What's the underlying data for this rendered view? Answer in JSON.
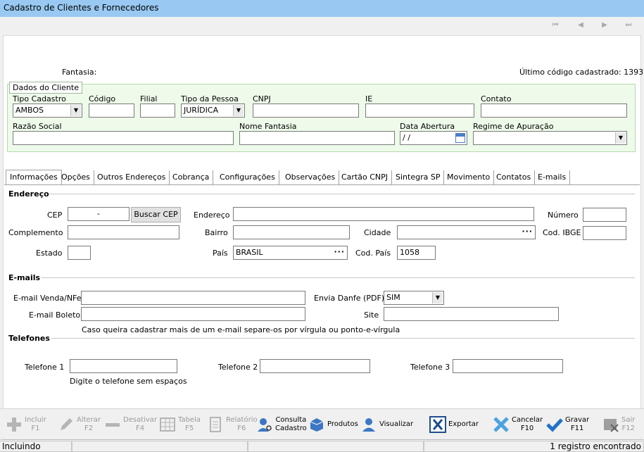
{
  "window": {
    "title": "Cadastro de Clientes e Fornecedores"
  },
  "nav": {
    "first": "⏮",
    "prev": "◀",
    "next": "▶",
    "last": "⏭"
  },
  "header": {
    "fantasia_label": "Fantasia:",
    "last_code": "Último código cadastrado: 1393"
  },
  "cliente": {
    "title": "Dados do Cliente",
    "tipo_cadastro": {
      "label": "Tipo Cadastro",
      "value": "AMBOS"
    },
    "codigo": {
      "label": "Código",
      "value": ""
    },
    "filial": {
      "label": "Filial",
      "value": ""
    },
    "tipo_pessoa": {
      "label": "Tipo da Pessoa",
      "value": "JURÍDICA"
    },
    "cnpj": {
      "label": "CNPJ",
      "value": ""
    },
    "ie": {
      "label": "IE",
      "value": ""
    },
    "contato": {
      "label": "Contato",
      "value": ""
    },
    "razao_social": {
      "label": "Razão Social",
      "value": ""
    },
    "nome_fantasia": {
      "label": "Nome Fantasia",
      "value": ""
    },
    "data_abertura": {
      "label": "Data Abertura",
      "value": " / /"
    },
    "regime": {
      "label": "Regime de Apuração",
      "value": ""
    }
  },
  "tabs": [
    "Informações",
    "Opções",
    "Outros Endereços",
    "Cobrança",
    "Configurações",
    "Observações",
    "Cartão CNPJ",
    "Sintegra SP",
    "Movimento",
    "Contatos",
    "E-mails"
  ],
  "endereco": {
    "section": "Endereço",
    "cep": {
      "label": "CEP",
      "value": "-"
    },
    "buscar_cep": "Buscar CEP",
    "endereco": {
      "label": "Endereço",
      "value": ""
    },
    "numero": {
      "label": "Número",
      "value": ""
    },
    "complemento": {
      "label": "Complemento",
      "value": ""
    },
    "bairro": {
      "label": "Bairro",
      "value": ""
    },
    "cidade": {
      "label": "Cidade",
      "value": ""
    },
    "cod_ibge": {
      "label": "Cod. IBGE",
      "value": ""
    },
    "estado": {
      "label": "Estado",
      "value": ""
    },
    "pais": {
      "label": "País",
      "value": "BRASIL"
    },
    "cod_pais": {
      "label": "Cod. País",
      "value": "1058"
    }
  },
  "emails": {
    "section": "E-mails",
    "venda": {
      "label": "E-mail Venda/NFe",
      "value": ""
    },
    "danfe": {
      "label": "Envia Danfe (PDF)",
      "value": "SIM"
    },
    "boleto": {
      "label": "E-mail Boleto",
      "value": ""
    },
    "site": {
      "label": "Site",
      "value": ""
    },
    "hint": "Caso queira cadastrar mais de um e-mail separe-os por vírgula ou ponto-e-vírgula"
  },
  "telefones": {
    "section": "Telefones",
    "tel1": {
      "label": "Telefone 1",
      "value": ""
    },
    "tel2": {
      "label": "Telefone 2",
      "value": ""
    },
    "tel3": {
      "label": "Telefone 3",
      "value": ""
    },
    "hint": "Digite o telefone sem espaços"
  },
  "toolbar": {
    "incluir": {
      "l1": "Incluir",
      "l2": "F1"
    },
    "alterar": {
      "l1": "Alterar",
      "l2": "F2"
    },
    "desativar": {
      "l1": "Desativar",
      "l2": "F4"
    },
    "tabela": {
      "l1": "Tabela",
      "l2": "F5"
    },
    "relatorio": {
      "l1": "Relatório",
      "l2": "F6"
    },
    "consulta": {
      "l1": "Consulta",
      "l2": "Cadastro"
    },
    "produtos": "Produtos",
    "visualizar": "Visualizar",
    "exportar": "Exportar",
    "cancelar": {
      "l1": "Cancelar",
      "l2": "F10"
    },
    "gravar": {
      "l1": "Gravar",
      "l2": "F11"
    },
    "sair": {
      "l1": "Sair",
      "l2": "F12"
    }
  },
  "status": {
    "mode": "Incluindo",
    "records": "1 registro encontrado"
  },
  "colors": {
    "titlebar": "#99c9f2",
    "group_bg": "#eefbea",
    "accent_blue": "#1e73c8"
  }
}
